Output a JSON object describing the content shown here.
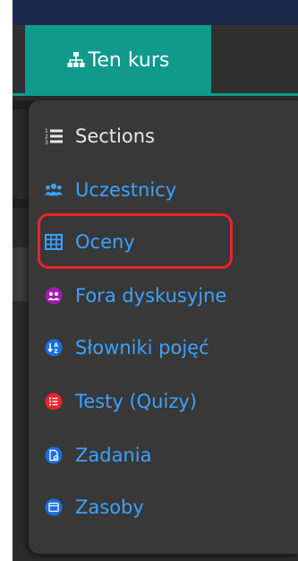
{
  "colors": {
    "accent": "#0f9a8c",
    "menu_bg": "#383838",
    "link_blue": "#3ba3ff",
    "highlight_red": "#e8242a"
  },
  "nav": {
    "course_tab": {
      "label": "Ten kurs",
      "icon": "sitemap-icon"
    }
  },
  "menu": {
    "items": [
      {
        "label": "Sections",
        "icon": "numbered-list-icon",
        "color": "#e8e8e8"
      },
      {
        "label": "Uczestnicy",
        "icon": "users-icon",
        "color": "#3ba3ff"
      },
      {
        "label": "Oceny",
        "icon": "table-icon",
        "color": "#3ba3ff"
      },
      {
        "label": "Fora dyskusyjne",
        "icon": "forum-icon",
        "color": "#3ba3ff"
      },
      {
        "label": "Słowniki pojęć",
        "icon": "glossary-icon",
        "color": "#3ba3ff"
      },
      {
        "label": "Testy (Quizy)",
        "icon": "quiz-icon",
        "color": "#3ba3ff"
      },
      {
        "label": "Zadania",
        "icon": "assignment-icon",
        "color": "#3ba3ff"
      },
      {
        "label": "Zasoby",
        "icon": "resource-icon",
        "color": "#3ba3ff"
      }
    ]
  }
}
